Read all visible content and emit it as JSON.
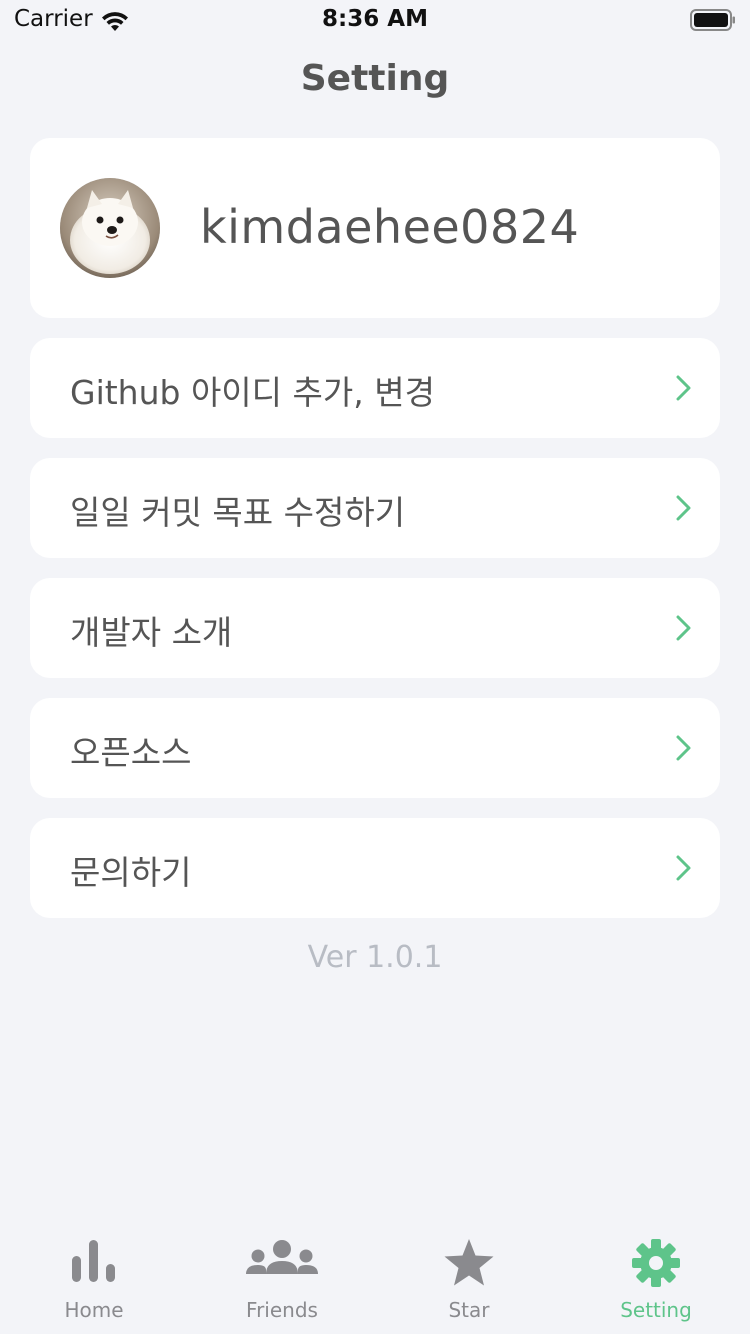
{
  "status_bar": {
    "carrier": "Carrier",
    "time": "8:36 AM"
  },
  "header": {
    "title": "Setting"
  },
  "profile": {
    "username": "kimdaehee0824",
    "avatar": "avatar-photo"
  },
  "menu": {
    "items": [
      {
        "label": "Github 아이디 추가, 변경",
        "icon": "chevron-right-icon"
      },
      {
        "label": "일일 커밋 목표 수정하기",
        "icon": "chevron-right-icon"
      },
      {
        "label": "개발자 소개",
        "icon": "chevron-right-icon"
      },
      {
        "label": "오픈소스",
        "icon": "chevron-right-icon"
      },
      {
        "label": "문의하기",
        "icon": "chevron-right-icon"
      }
    ]
  },
  "version": "Ver 1.0.1",
  "tab_bar": {
    "tabs": [
      {
        "label": "Home",
        "icon": "bar-chart-icon",
        "active": false
      },
      {
        "label": "Friends",
        "icon": "people-icon",
        "active": false
      },
      {
        "label": "Star",
        "icon": "star-icon",
        "active": false
      },
      {
        "label": "Setting",
        "icon": "gear-icon",
        "active": true
      }
    ]
  },
  "colors": {
    "accent": "#5ec48a",
    "background": "#f3f4f8",
    "card": "#ffffff",
    "text": "#555555",
    "muted": "#b8bcc4",
    "tab_inactive": "#8a8a8e"
  }
}
